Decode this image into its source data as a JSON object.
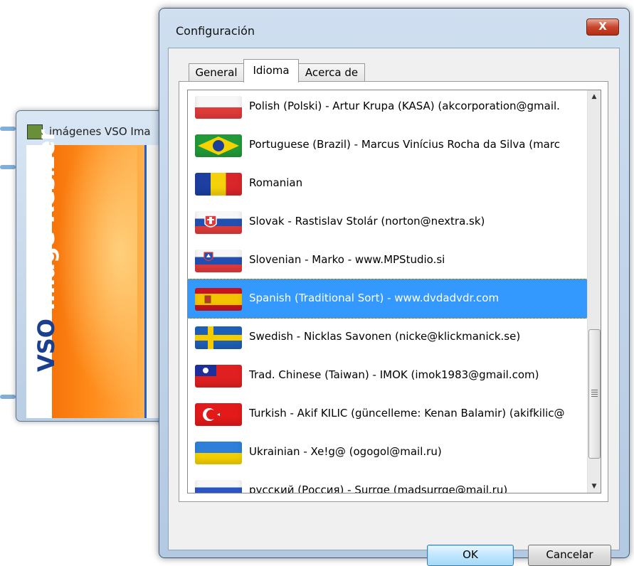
{
  "background_window": {
    "title": "imágenes VSO Ima",
    "banner_brand": "VSO",
    "banner_text": "Image Resizer"
  },
  "dialog": {
    "title": "Configuración",
    "close_glyph": "X",
    "tabs": [
      {
        "label": "General",
        "active": false
      },
      {
        "label": "Idioma",
        "active": true
      },
      {
        "label": "Acerca de",
        "active": false
      }
    ],
    "languages": [
      {
        "label": "Polish (Polski) - Artur Krupa (KASA) (akcorporation@gmail.",
        "flag": "poland-flag-icon"
      },
      {
        "label": "Portuguese (Brazil) - Marcus Vinícius Rocha da Silva (marc",
        "flag": "brazil-flag-icon"
      },
      {
        "label": "Romanian",
        "flag": "romania-flag-icon"
      },
      {
        "label": "Slovak - Rastislav Stolár (norton@nextra.sk)",
        "flag": "slovakia-flag-icon"
      },
      {
        "label": "Slovenian - Marko - www.MPStudio.si",
        "flag": "slovenia-flag-icon"
      },
      {
        "label": "Spanish (Traditional Sort) - www.dvdadvdr.com",
        "flag": "spain-flag-icon",
        "selected": true
      },
      {
        "label": "Swedish - Nicklas Savonen (nicke@klickmanick.se)",
        "flag": "sweden-flag-icon"
      },
      {
        "label": "Trad. Chinese (Taiwan) - IMOK (imok1983@gmail.com)",
        "flag": "taiwan-flag-icon"
      },
      {
        "label": "Turkish - Akif KILIC (güncelleme: Kenan Balamir) (akifkilic@",
        "flag": "turkey-flag-icon"
      },
      {
        "label": "Ukrainian - Xe!g@ (ogogol@mail.ru)",
        "flag": "ukraine-flag-icon"
      },
      {
        "label": "русский (Россия) - Surrge (madsurrge@mail.ru)",
        "flag": "russia-flag-icon"
      }
    ],
    "ok_label": "OK",
    "cancel_label": "Cancelar"
  },
  "colors": {
    "selection": "#3399ff",
    "close_button": "#c8452b"
  }
}
